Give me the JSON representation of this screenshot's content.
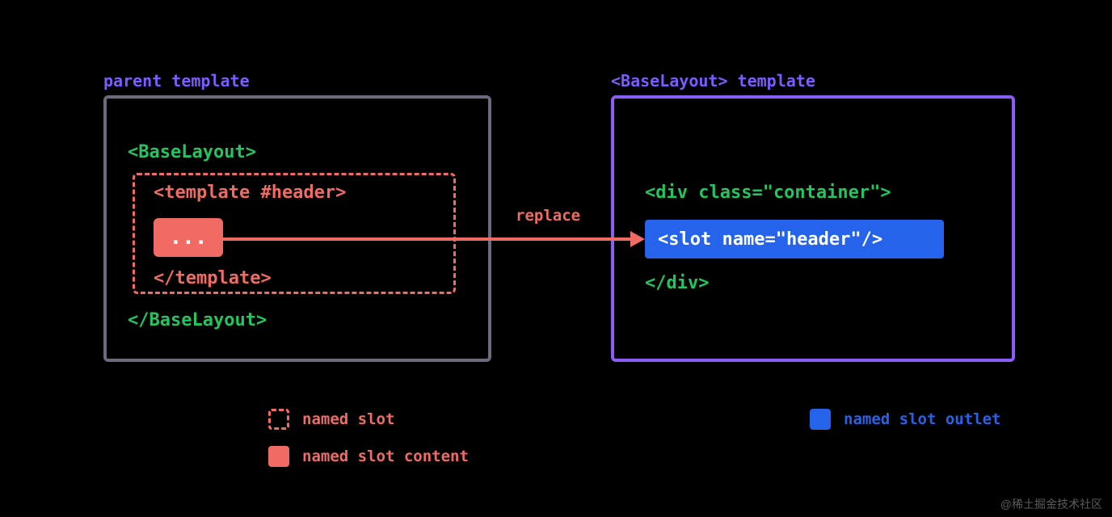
{
  "left": {
    "title": "parent template",
    "open": "<BaseLayout>",
    "tplOpen": "<template #header>",
    "dots": "...",
    "tplClose": "</template>",
    "close": "</BaseLayout>"
  },
  "right": {
    "title": "<BaseLayout> template",
    "divOpen": "<div class=\"container\">",
    "slot": "<slot name=\"header\"/>",
    "divClose": "</div>"
  },
  "arrow": {
    "label": "replace"
  },
  "legend": {
    "namedSlot": "named slot",
    "namedSlotContent": "named slot content",
    "namedSlotOutlet": "named slot outlet"
  },
  "watermark": "@稀土掘金技术社区"
}
